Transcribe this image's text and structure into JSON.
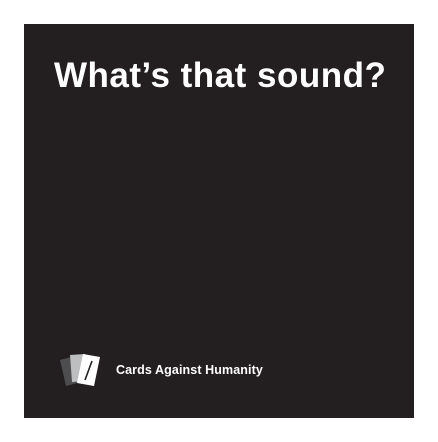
{
  "card": {
    "prompt": "What’s that sound?",
    "brand_name": "Cards Against Humanity",
    "logo_icon": "stacked-cards-logo-icon",
    "colors": {
      "card_background": "#231f20",
      "text": "#ffffff",
      "page_background": "#ffffff"
    }
  }
}
